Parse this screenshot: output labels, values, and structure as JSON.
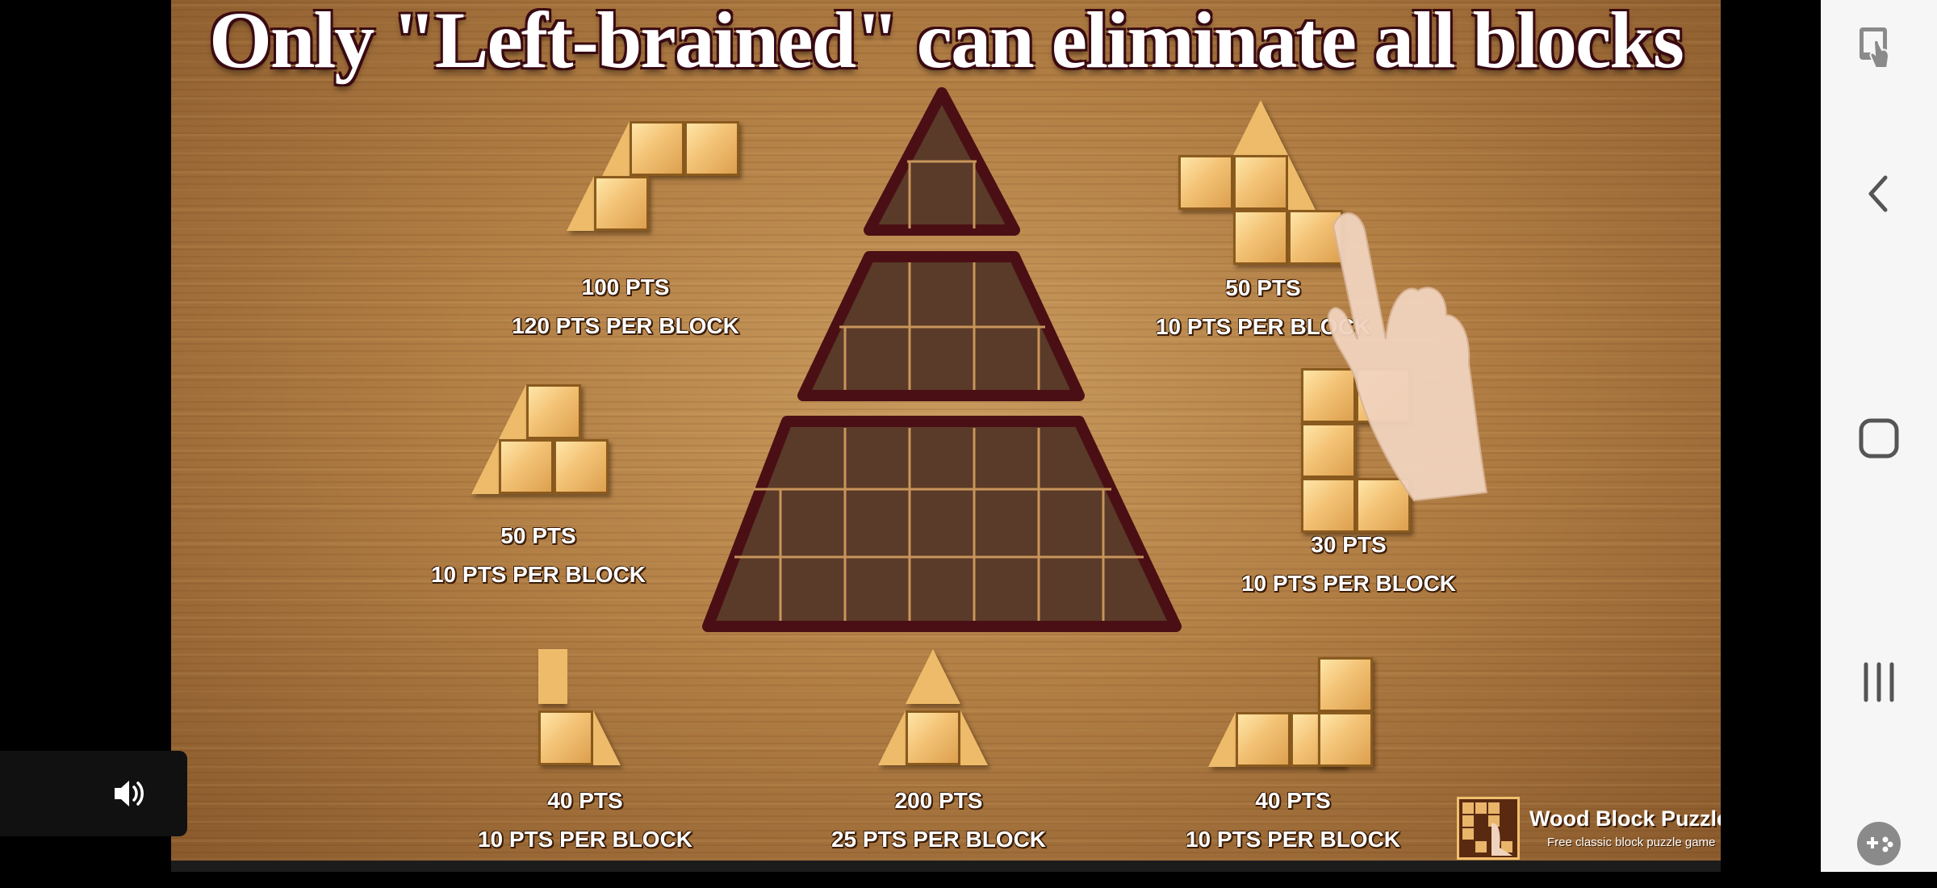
{
  "ad": {
    "title": "Only \"Left-brained\" can eliminate all blocks",
    "pieces": [
      {
        "pts": "100 PTS",
        "per_block": "120 PTS PER BLOCK"
      },
      {
        "pts": "50 PTS",
        "per_block": "10 PTS PER BLOCK"
      },
      {
        "pts": "50 PTS",
        "per_block": "10 PTS PER BLOCK"
      },
      {
        "pts": "30 PTS",
        "per_block": "10 PTS PER BLOCK"
      },
      {
        "pts": "40 PTS",
        "per_block": "10 PTS PER BLOCK"
      },
      {
        "pts": "200 PTS",
        "per_block": "25 PTS PER BLOCK"
      },
      {
        "pts": "40 PTS",
        "per_block": "10 PTS PER BLOCK"
      }
    ],
    "logo": {
      "title": "Wood Block Puzzle",
      "subtitle": "Free classic block puzzle game"
    }
  },
  "controls": {
    "sound_icon": "speaker-icon"
  },
  "navbar": {
    "items": [
      {
        "icon": "screen-touch-icon"
      },
      {
        "icon": "back-icon"
      },
      {
        "icon": "home-icon"
      },
      {
        "icon": "recents-icon"
      },
      {
        "icon": "game-controller-icon"
      }
    ]
  },
  "colors": {
    "wood": "#b27f45",
    "block": "#f3c275",
    "board": "#4a2a18",
    "outline": "#4a0f14",
    "navbar": "#f6f6f6"
  }
}
